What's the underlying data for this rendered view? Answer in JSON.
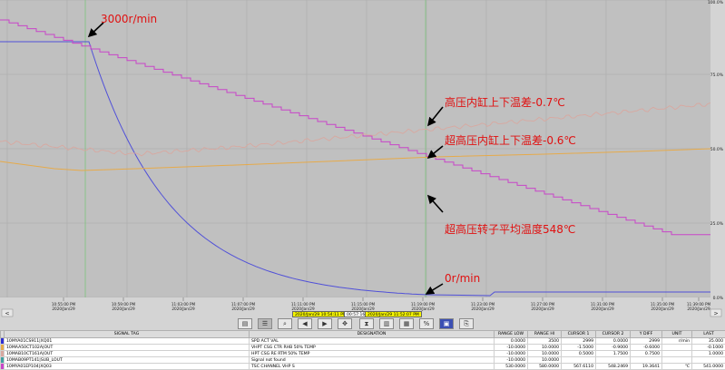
{
  "colors": {
    "plot_bg": "#c0c0c0",
    "grid": "#a9a9a9",
    "speed": "#5050d8",
    "temp": "#c845c8",
    "hp_diff": "#d8a8a0",
    "ihp_diff": "#e6aa4a",
    "annotation": "#e01010",
    "cursor": "#7cc47c"
  },
  "annotations": [
    {
      "text": "3000r/min"
    },
    {
      "text": "高压内缸上下温差-0.7℃"
    },
    {
      "text": "超高压内缸上下温差-0.6℃"
    },
    {
      "text": "超高压转子平均温度548℃"
    },
    {
      "text": "0r/min"
    }
  ],
  "time_ticks": [
    {
      "time": "10:55:00 PM",
      "date": "2020/Jan/29"
    },
    {
      "time": "10:59:00 PM",
      "date": "2020/Jan/29"
    },
    {
      "time": "11:03:00 PM",
      "date": "2020/Jan/29"
    },
    {
      "time": "11:07:00 PM",
      "date": "2020/Jan/29"
    },
    {
      "time": "11:11:00 PM",
      "date": "2020/Jan/29"
    },
    {
      "time": "11:15:00 PM",
      "date": "2020/Jan/29"
    },
    {
      "time": "11:19:00 PM",
      "date": "2020/Jan/29"
    },
    {
      "time": "11:23:00 PM",
      "date": "2020/Jan/29"
    },
    {
      "time": "11:27:00 PM",
      "date": "2020/Jan/29"
    },
    {
      "time": "11:31:00 PM",
      "date": "2020/Jan/29"
    },
    {
      "time": "11:35:00 PM",
      "date": "2020/Jan/29"
    },
    {
      "time": "11:39:00 PM",
      "date": "2020/Jan/29"
    }
  ],
  "percent_ticks": [
    "100.0%",
    "75.0%",
    "50.0%",
    "25.0%",
    "0.0%"
  ],
  "cursor_labels": {
    "cursor1": "2020/Jan/29 10:54:11 PM",
    "span": "00:57:16",
    "cursor2": "2020/Jan/29 11:52:07 PM"
  },
  "nav": {
    "left": "<",
    "right": ">"
  },
  "toolbar_icons": [
    "book-icon",
    "list-icon",
    "zoom-icon",
    "move-icon",
    "play-back-icon",
    "play-forward-icon",
    "stop-icon",
    "percent-icon",
    "save-icon",
    "export-icon"
  ],
  "table": {
    "headers": [
      "",
      "SIGNAL TAG",
      "DESIGNATION",
      "RANGE LOW",
      "RANGE HI",
      "CURSOR 1",
      "CURSOR 2",
      "Y DIFF",
      "UNIT",
      "LAST"
    ],
    "rows": [
      {
        "color": "#3030d0",
        "tag": "10MYA01CS911|XQ01",
        "designation": "SPD ACT VAL",
        "low": "0.0000",
        "hi": "3500",
        "c1": "2999",
        "c2": "0.0000",
        "ydiff": "2999",
        "unit": "r/min",
        "last": "35.000"
      },
      {
        "color": "#e6aa4a",
        "tag": "10MAA50CT102A|OUT",
        "designation": "VHPT CSG CTR RHB 50% TEMP",
        "low": "-10.0000",
        "hi": "10.0000",
        "c1": "-1.5000",
        "c2": "-0.9000",
        "ydiff": "-0.6000",
        "unit": "",
        "last": "-0.1000"
      },
      {
        "color": "#d8a8a0",
        "tag": "10MAB10CT161A|OUT",
        "designation": "HPT CSG RE RTM 50% TEMP",
        "low": "-10.0000",
        "hi": "10.0000",
        "c1": "0.5000",
        "c2": "1.7500",
        "ydiff": "0.7500",
        "unit": "",
        "last": "1.0000"
      },
      {
        "color": "#40a0a0",
        "tag": "10MAB09PT141|SUB_LOUT",
        "designation": "Signal not found",
        "low": "-10.0000",
        "hi": "10.0000",
        "c1": "",
        "c2": "",
        "ydiff": "",
        "unit": "",
        "last": ""
      },
      {
        "color": "#c845c8",
        "tag": "10MYA01EP104|XQ03",
        "designation": "TSC CHANNEL VHP S",
        "low": "530.0000",
        "hi": "580.0000",
        "c1": "567.6110",
        "c2": "548.2469",
        "ydiff": "19.3641",
        "unit": "℃",
        "last": "541.0000"
      }
    ]
  }
}
